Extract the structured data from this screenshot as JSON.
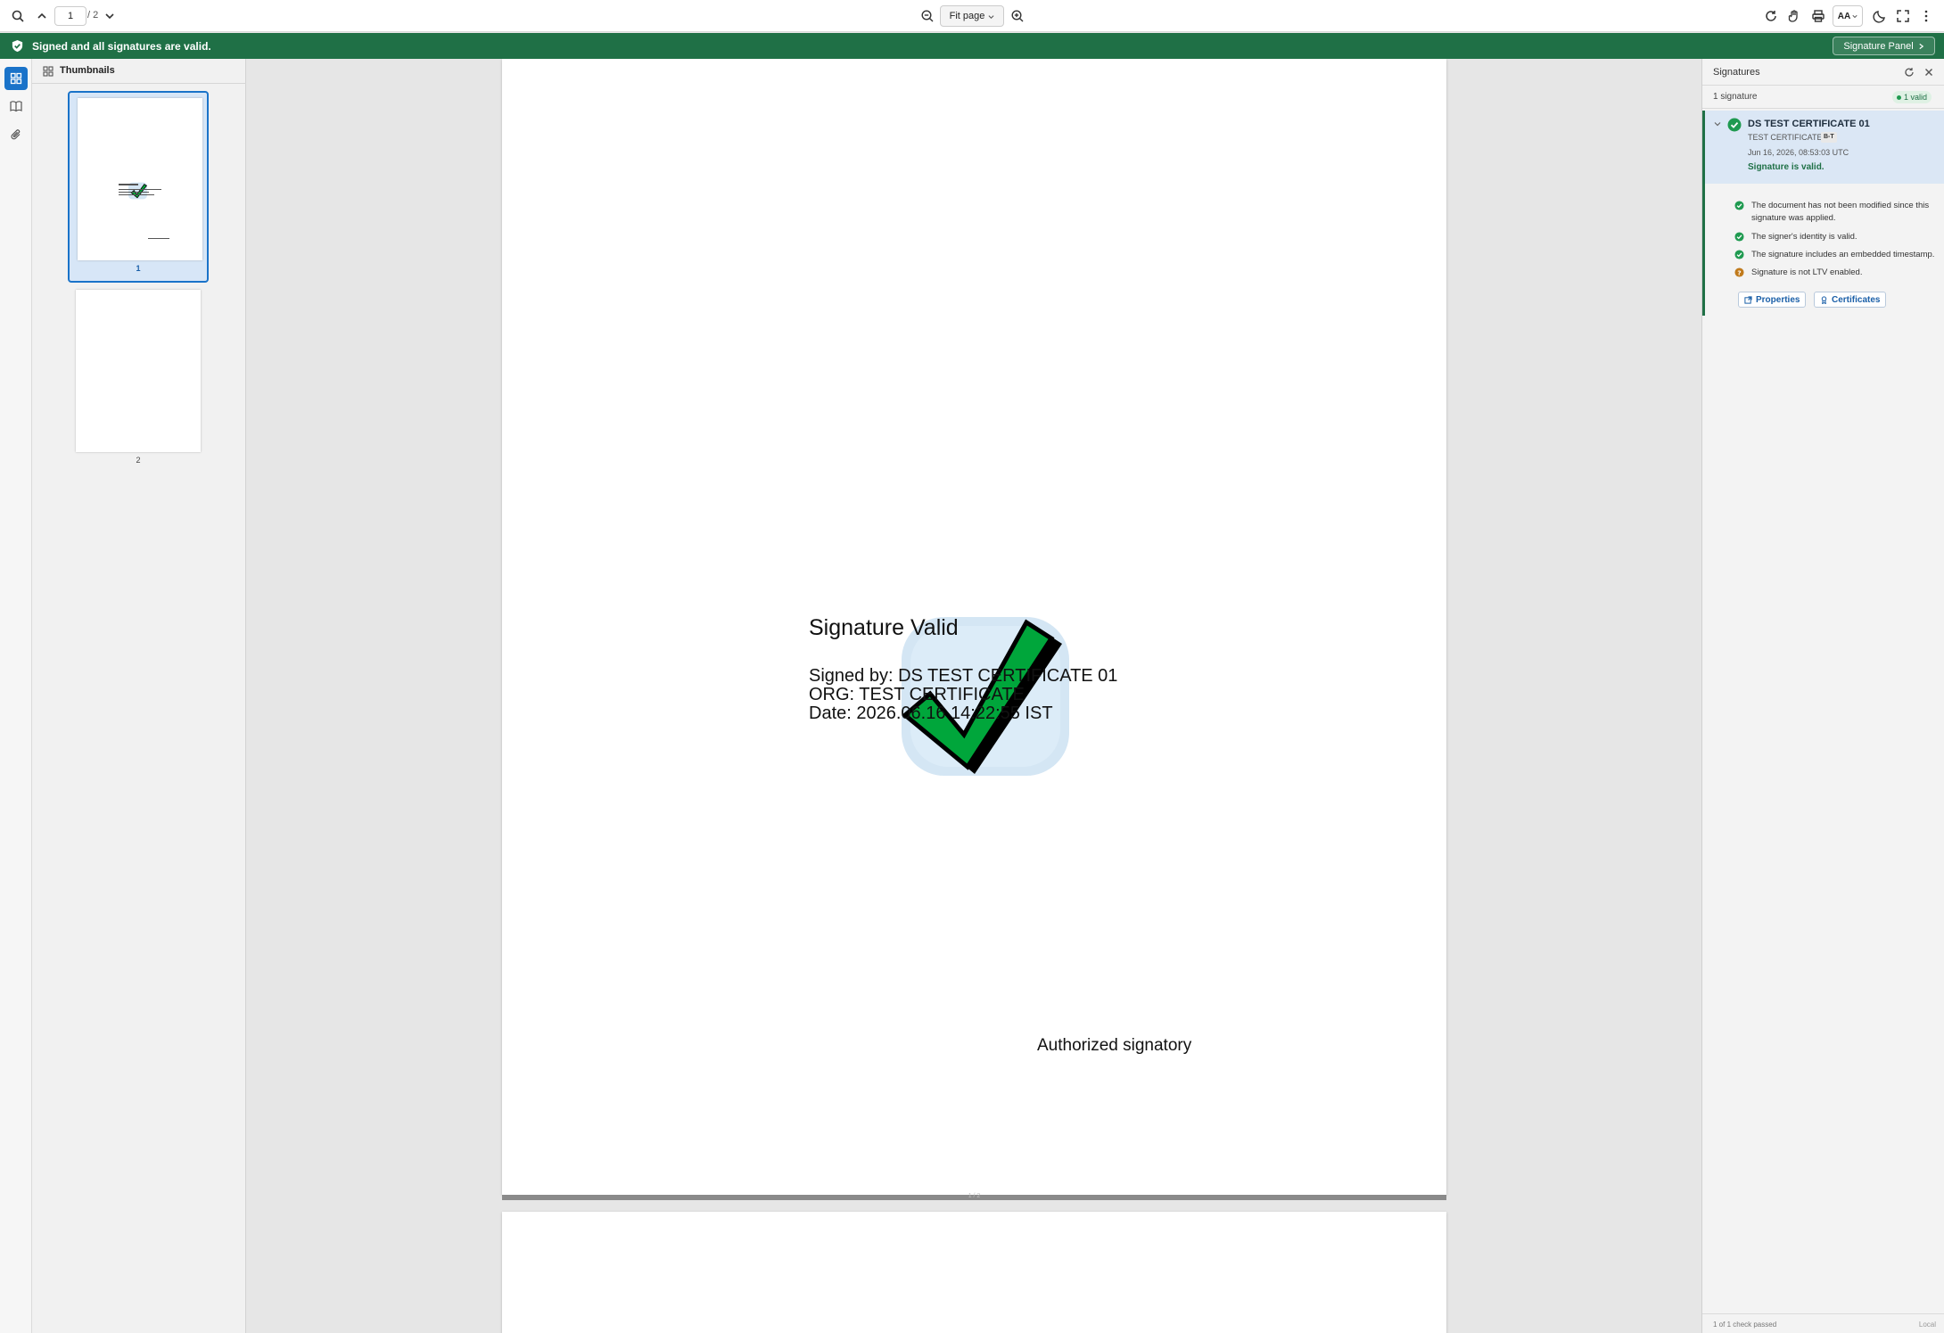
{
  "toolbar": {
    "current_page": "1",
    "total_pages": "/ 2",
    "zoom_label": "Fit page",
    "text_size_label": "AA"
  },
  "banner": {
    "message": "Signed and all signatures are valid.",
    "panel_button": "Signature Panel"
  },
  "thumbnails": {
    "title": "Thumbnails",
    "items": [
      {
        "label": "1"
      },
      {
        "label": "2"
      }
    ]
  },
  "document": {
    "sig_title": "Signature Valid",
    "signed_by": "Signed by: DS TEST CERTIFICATE 01",
    "org": "ORG: TEST CERTIFICATE",
    "date": "Date: 2026.06.16 14:22:55 IST",
    "authorized": "Authorized signatory",
    "page_indicator": "1 / 2"
  },
  "signatures_panel": {
    "title": "Signatures",
    "count_text": "1 signature",
    "valid_badge": "1 valid",
    "signature": {
      "name": "DS TEST CERTIFICATE 01",
      "org": "TEST CERTIFICATE",
      "level_badge": "B-T",
      "date": "Jun 16, 2026, 08:53:03 UTC",
      "status": "Signature is valid."
    },
    "checks": [
      {
        "text": "The document has not been modified since this signature was applied.",
        "state": "ok"
      },
      {
        "text": "The signer's identity is valid.",
        "state": "ok"
      },
      {
        "text": "The signature includes an embedded timestamp.",
        "state": "ok"
      },
      {
        "text": "Signature is not LTV enabled.",
        "state": "warn"
      }
    ],
    "properties_button": "Properties",
    "certificates_button": "Certificates",
    "footer_left": "1 of 1 check passed",
    "footer_right": "Local"
  },
  "colors": {
    "banner_green": "#1f7046",
    "accent_blue": "#1a73c9",
    "check_green": "#1f9a50",
    "warn_amber": "#c07a1c"
  }
}
